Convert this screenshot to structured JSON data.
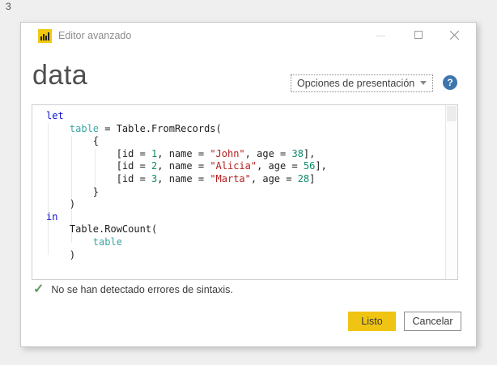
{
  "page": {
    "corner_label": "3"
  },
  "window": {
    "title": "Editor avanzado",
    "icons": [
      "powerbi-bar-chart-icon",
      "minimize-icon",
      "maximize-icon",
      "close-icon"
    ]
  },
  "header": {
    "query_name": "data",
    "display_options_label": "Opciones de presentación",
    "help_glyph": "?"
  },
  "editor": {
    "code_lines": [
      [
        {
          "t": "kw",
          "v": "let"
        }
      ],
      [
        {
          "t": "plain",
          "v": "    "
        },
        {
          "t": "id",
          "v": "table"
        },
        {
          "t": "plain",
          "v": " = Table.FromRecords("
        }
      ],
      [
        {
          "t": "plain",
          "v": "        {"
        }
      ],
      [
        {
          "t": "plain",
          "v": "            [id = "
        },
        {
          "t": "num",
          "v": "1"
        },
        {
          "t": "plain",
          "v": ", name = "
        },
        {
          "t": "str",
          "v": "\"John\""
        },
        {
          "t": "plain",
          "v": ", age = "
        },
        {
          "t": "num",
          "v": "38"
        },
        {
          "t": "plain",
          "v": "],"
        }
      ],
      [
        {
          "t": "plain",
          "v": "            [id = "
        },
        {
          "t": "num",
          "v": "2"
        },
        {
          "t": "plain",
          "v": ", name = "
        },
        {
          "t": "str",
          "v": "\"Alicia\""
        },
        {
          "t": "plain",
          "v": ", age = "
        },
        {
          "t": "num",
          "v": "56"
        },
        {
          "t": "plain",
          "v": "],"
        }
      ],
      [
        {
          "t": "plain",
          "v": "            [id = "
        },
        {
          "t": "num",
          "v": "3"
        },
        {
          "t": "plain",
          "v": ", name = "
        },
        {
          "t": "str",
          "v": "\"Marta\""
        },
        {
          "t": "plain",
          "v": ", age = "
        },
        {
          "t": "num",
          "v": "28"
        },
        {
          "t": "plain",
          "v": "]"
        }
      ],
      [
        {
          "t": "plain",
          "v": "        }"
        }
      ],
      [
        {
          "t": "plain",
          "v": "    )"
        }
      ],
      [
        {
          "t": "kw",
          "v": "in"
        }
      ],
      [
        {
          "t": "plain",
          "v": "    Table.RowCount("
        }
      ],
      [
        {
          "t": "plain",
          "v": "        "
        },
        {
          "t": "id",
          "v": "table"
        }
      ],
      [
        {
          "t": "plain",
          "v": "    )"
        }
      ]
    ]
  },
  "status": {
    "check_glyph": "✓",
    "message": "No se han detectado errores de sintaxis."
  },
  "footer": {
    "done_label": "Listo",
    "cancel_label": "Cancelar"
  },
  "colors": {
    "accent_yellow": "#f0c412",
    "help_blue": "#3c76ad",
    "check_green": "#5f9b62",
    "code_keyword": "#0d0dd0",
    "code_identifier": "#3ba5a5",
    "code_number": "#0e8a6c",
    "code_string": "#b42020"
  }
}
